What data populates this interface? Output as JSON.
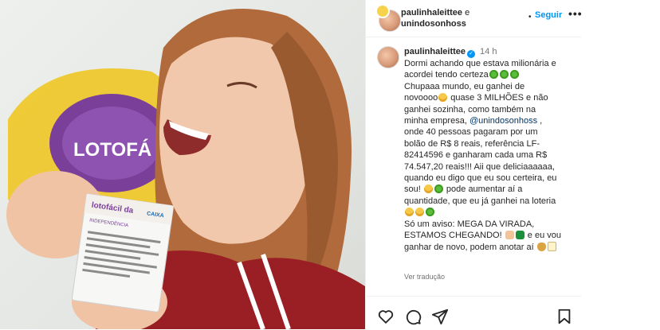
{
  "post": {
    "header": {
      "user1": "paulinhaleittee",
      "connector": "e",
      "user2": "unindosonhoss",
      "dot": "•",
      "follow_label": "Seguir",
      "more_icon": "•••"
    },
    "caption": {
      "username": "paulinhaleittee",
      "verified": "✓",
      "time": "14 h",
      "lines": [
        "Dormi achando que estava milionária e",
        "acordei tendo certeza",
        "Chupaaa mundo, eu ganhei de",
        "novoooo",
        " quase 3 MILHÕES e não",
        "ganhei sozinha, como também na",
        "minha empresa,",
        "@unindosonhoss",
        " ,",
        "onde 40 pessoas pagaram por um",
        "bolão de R$ 8 reais, referência LF-",
        "82414596 e ganharam cada uma R$",
        "74.547,20 reais!!! Aii que deliciaaaaaa,",
        "quando eu digo que eu sou certeira, eu",
        "sou!",
        " pode aumentar aí a",
        "quantidade, que eu já ganhei na loteria",
        "Só um aviso: MEGA DA VIRADA,",
        "ESTAMOS CHEGANDO!",
        " e eu vou",
        "ganhar de novo, podem anotar aí"
      ],
      "see_translation": "Ver tradução"
    },
    "photo": {
      "ticket_title": "lotofácil da",
      "ticket_subtitle": "INDEPENDÊNCIA",
      "ticket_brand": "CAIXA",
      "bg_sign_text": "LOTOFÁ"
    },
    "actions": {
      "icons": [
        "heart-icon",
        "comment-icon",
        "share-icon",
        "save-icon"
      ]
    },
    "colors": {
      "accent": "#0095f6",
      "text": "#262626",
      "secondary": "#737373",
      "mention": "#00376b"
    }
  }
}
